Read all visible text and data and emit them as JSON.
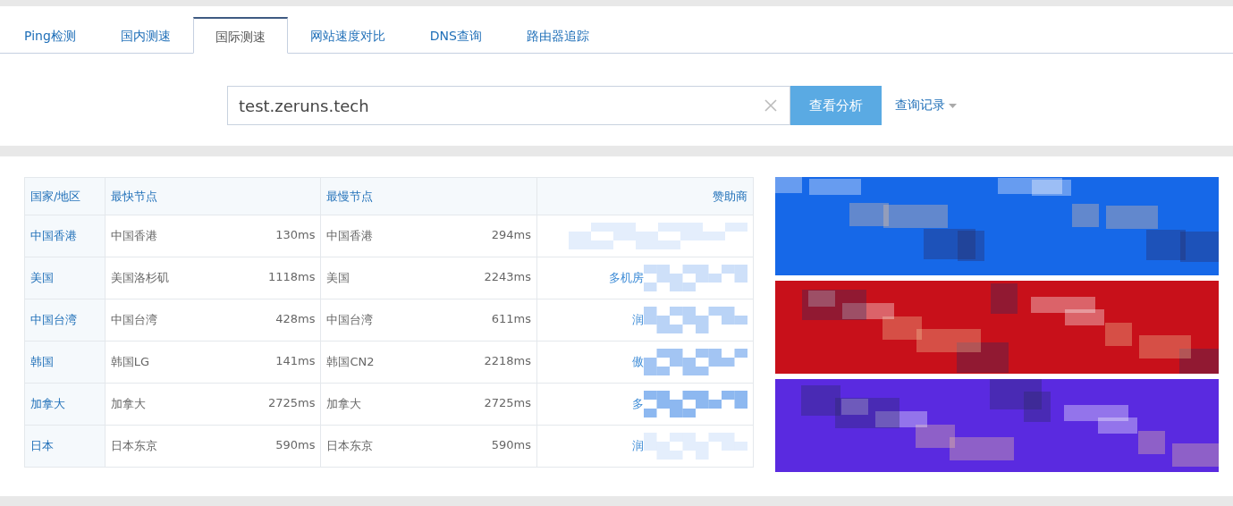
{
  "tabs": [
    {
      "label": "Ping检测",
      "selected": false
    },
    {
      "label": "国内测速",
      "selected": false
    },
    {
      "label": "国际测速",
      "selected": true
    },
    {
      "label": "网站速度对比",
      "selected": false
    },
    {
      "label": "DNS查询",
      "selected": false
    },
    {
      "label": "路由器追踪",
      "selected": false
    }
  ],
  "search": {
    "value": "test.zeruns.tech",
    "button": "查看分析",
    "history": "查询记录"
  },
  "table": {
    "columns": [
      "国家/地区",
      "最快节点",
      "最慢节点",
      "赞助商"
    ],
    "rows": [
      {
        "region": "中国香港",
        "fastest_node": "中国香港",
        "fastest_time": "130ms",
        "slowest_node": "中国香港",
        "slowest_time": "294ms"
      },
      {
        "region": "美国",
        "fastest_node": "美国洛杉矶",
        "fastest_time": "1118ms",
        "slowest_node": "美国",
        "slowest_time": "2243ms",
        "sponsor": "多机房"
      },
      {
        "region": "中国台湾",
        "fastest_node": "中国台湾",
        "fastest_time": "428ms",
        "slowest_node": "中国台湾",
        "slowest_time": "611ms",
        "sponsor": "润"
      },
      {
        "region": "韩国",
        "fastest_node": "韩国LG",
        "fastest_time": "141ms",
        "slowest_node": "韩国CN2",
        "slowest_time": "2218ms",
        "sponsor": "傲"
      },
      {
        "region": "加拿大",
        "fastest_node": "加拿大",
        "fastest_time": "2725ms",
        "slowest_node": "加拿大",
        "slowest_time": "2725ms",
        "sponsor": "多"
      },
      {
        "region": "日本",
        "fastest_node": "日本东京",
        "fastest_time": "590ms",
        "slowest_node": "日本东京",
        "slowest_time": "590ms",
        "sponsor": "润"
      }
    ]
  }
}
